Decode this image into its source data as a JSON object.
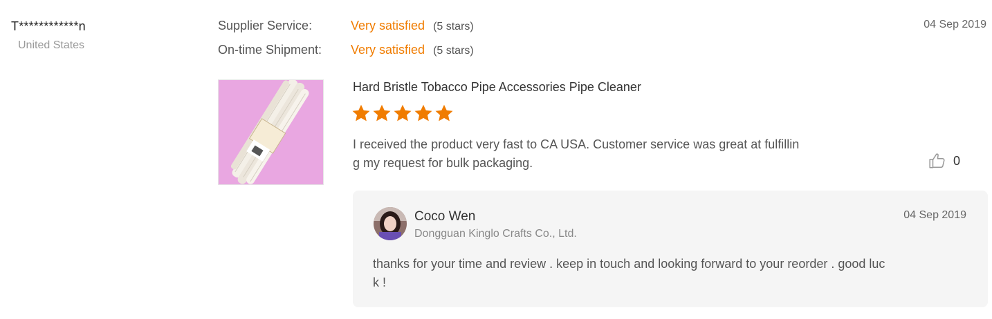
{
  "reviewer": {
    "name": "T************n",
    "country": "United States"
  },
  "ratings": [
    {
      "label": "Supplier Service:",
      "value": "Very satisfied",
      "stars": "(5 stars)"
    },
    {
      "label": "On-time Shipment:",
      "value": "Very satisfied",
      "stars": "(5 stars)"
    }
  ],
  "review": {
    "date": "04 Sep 2019",
    "product_title": "Hard Bristle Tobacco Pipe Accessories Pipe Cleaner",
    "rating": 5,
    "text_line1": "I received the product very fast to CA USA. Customer service was great at fulfillin",
    "text_line2": "g my request for bulk packaging.",
    "likes": "0",
    "like_icon": "thumbs-up-icon",
    "star_color": "#f07c00"
  },
  "reply": {
    "name": "Coco Wen",
    "company": "Dongguan Kinglo Crafts Co., Ltd.",
    "date": "04 Sep 2019",
    "text_line1": "thanks for your time and review . keep in touch and looking forward to your reorder .  good luc",
    "text_line2": "k !"
  },
  "colors": {
    "accent": "#f07c00",
    "reply_background": "#f5f5f5"
  }
}
